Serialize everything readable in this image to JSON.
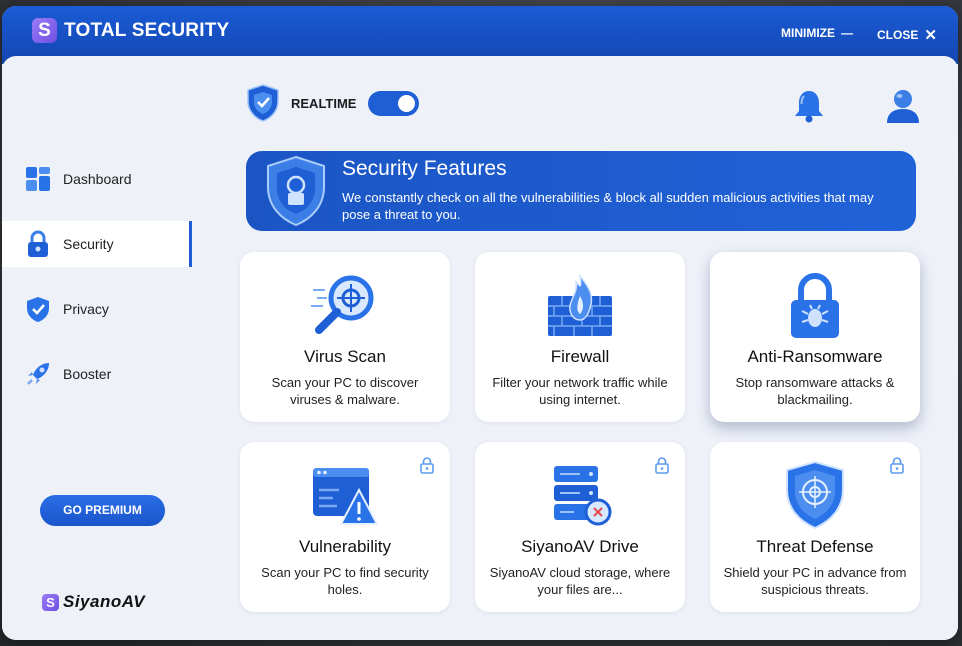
{
  "app": {
    "logo_letter": "S",
    "title": "TOTAL SECURITY",
    "minimize_label": "MINIMIZE",
    "minimize_icon": "—",
    "close_label": "CLOSE",
    "close_icon": "✕"
  },
  "sidebar": {
    "items": [
      {
        "label": "Dashboard",
        "icon": "dashboard-grid-icon"
      },
      {
        "label": "Security",
        "icon": "padlock-icon",
        "active": true
      },
      {
        "label": "Privacy",
        "icon": "shield-check-icon"
      },
      {
        "label": "Booster",
        "icon": "rocket-icon"
      }
    ],
    "premium_button": "GO PREMIUM",
    "brand_letter": "S",
    "brand_name": "SiyanoAV"
  },
  "topbar": {
    "realtime_label": "REALTIME",
    "realtime_on": true
  },
  "banner": {
    "title": "Security Features",
    "description": "We constantly check on all the vulnerabilities  & block all sudden malicious activities that may pose a threat to you."
  },
  "features": [
    {
      "title": "Virus Scan",
      "description": "Scan your PC to discover viruses & malware.",
      "icon": "magnifier-scan-icon",
      "locked": false
    },
    {
      "title": "Firewall",
      "description": "Filter your network traffic while using internet.",
      "icon": "firewall-flame-icon",
      "locked": false
    },
    {
      "title": "Anti-Ransomware",
      "description": "Stop ransomware attacks & blackmailing.",
      "icon": "padlock-bug-icon",
      "locked": false
    },
    {
      "title": "Vulnerability",
      "description": "Scan your PC to find security holes.",
      "icon": "window-warning-icon",
      "locked": true
    },
    {
      "title": "SiyanoAV Drive",
      "description": "SiyanoAV cloud storage, where your files are...",
      "icon": "server-drive-icon",
      "locked": true
    },
    {
      "title": "Threat Defense",
      "description": "Shield your PC in advance from suspicious threats.",
      "icon": "shield-target-icon",
      "locked": true
    }
  ],
  "colors": {
    "accent": "#1e5fd6",
    "titlebar": "#1446b0",
    "panel_bg": "#eef1f8"
  }
}
